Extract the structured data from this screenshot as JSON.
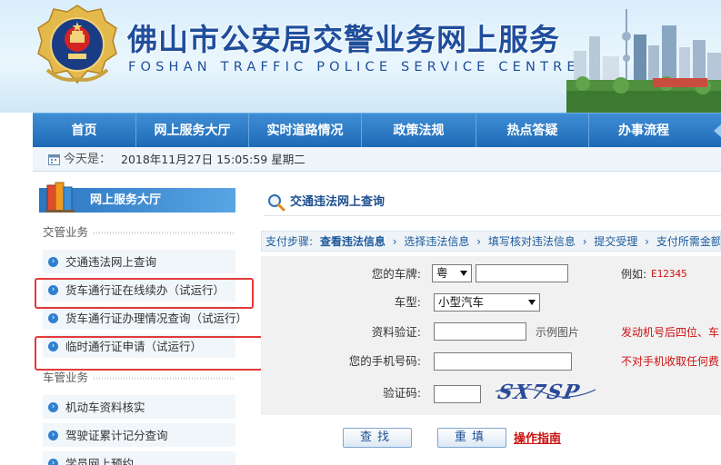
{
  "header": {
    "title": "佛山市公安局交警业务网上服务",
    "subtitle": "FOSHAN TRAFFIC POLICE SERVICE CENTRE"
  },
  "nav": {
    "items": [
      {
        "label": "首页"
      },
      {
        "label": "网上服务大厅"
      },
      {
        "label": "实时道路情况"
      },
      {
        "label": "政策法规"
      },
      {
        "label": "热点答疑"
      },
      {
        "label": "办事流程"
      }
    ]
  },
  "date_bar": {
    "label": "今天是：",
    "value": "2018年11月27日 15:05:59 星期二"
  },
  "sidebar": {
    "header": "网上服务大厅",
    "sections": [
      {
        "title": "交管业务",
        "items": [
          {
            "label": "交通违法网上查询",
            "highlighted": false
          },
          {
            "label": "货车通行证在线续办（试运行）",
            "highlighted": true
          },
          {
            "label": "货车通行证办理情况查询（试运行）",
            "highlighted": false
          },
          {
            "label": "临时通行证申请（试运行）",
            "highlighted": true
          }
        ]
      },
      {
        "title": "车管业务",
        "items": [
          {
            "label": "机动车资料核实",
            "highlighted": false
          },
          {
            "label": "驾驶证累计记分查询",
            "highlighted": false
          },
          {
            "label": "学员网上预约",
            "highlighted": false
          }
        ]
      }
    ]
  },
  "main": {
    "title": "交通违法网上查询",
    "steps": {
      "label": "支付步骤:",
      "items": [
        "查看违法信息",
        "选择违法信息",
        "填写核对违法信息",
        "提交受理",
        "支付所需金额"
      ],
      "current": 0
    },
    "form": {
      "plate_label": "您的车牌:",
      "plate_prefix": "粤",
      "plate_value": "",
      "plate_example": "例如:",
      "plate_example_value": "E12345",
      "vehicle_type_label": "车型:",
      "vehicle_type_value": "小型汽车",
      "verify_label": "资料验证:",
      "verify_value": "",
      "verify_sample": "示例图片",
      "verify_hint": "发动机号后四位、车",
      "phone_label": "您的手机号码:",
      "phone_value": "",
      "phone_hint": "不对手机收取任何费",
      "captcha_label": "验证码:",
      "captcha_value": "",
      "captcha_image_text": "SX7SP"
    },
    "buttons": {
      "search": "查找",
      "reset": "重填",
      "guide": "操作指南"
    }
  },
  "colors": {
    "brand_blue": "#1f4e9c",
    "nav_blue": "#1f6ab6",
    "highlight_red": "#e23a3a",
    "hint_red": "#cc1111"
  }
}
